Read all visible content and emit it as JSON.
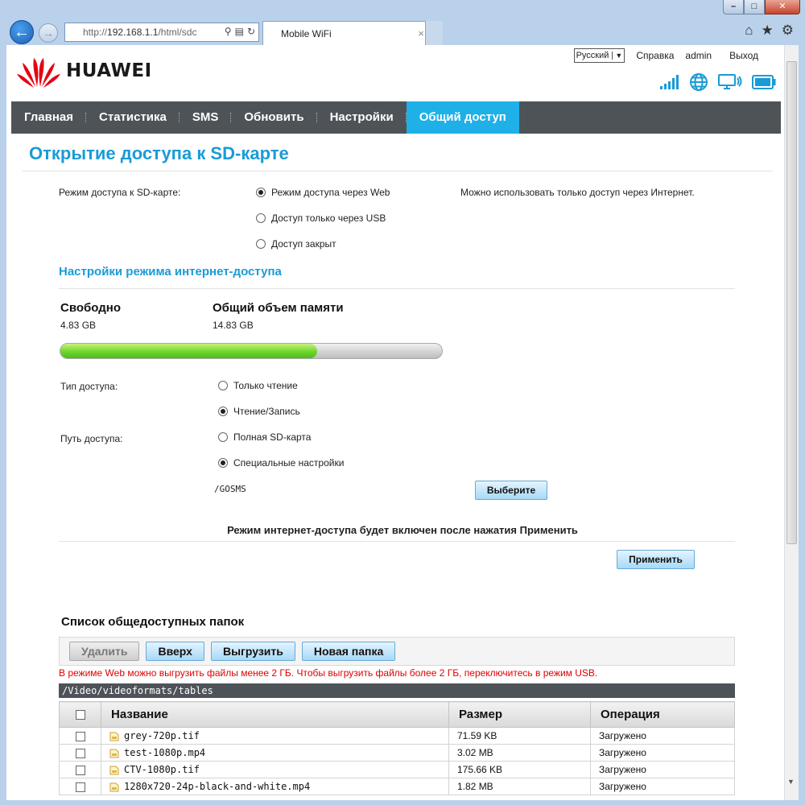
{
  "browser": {
    "address_prefix": "http://",
    "address_host": "192.168.1.1",
    "address_path": "/html/sdc",
    "tab_title": "Mobile WiFi",
    "tab_close": "×",
    "window_buttons": [
      "–",
      "□",
      "✕"
    ]
  },
  "header": {
    "logo_text": "HUAWEI",
    "language": "Русский",
    "links": {
      "help": "Справка",
      "user": "admin",
      "logout": "Выход"
    },
    "status_icons": [
      "signal-strength-icon",
      "globe-icon",
      "monitor-wifi-icon",
      "battery-icon"
    ]
  },
  "nav": {
    "items": [
      "Главная",
      "Статистика",
      "SMS",
      "Обновить",
      "Настройки",
      "Общий доступ"
    ],
    "active_index": 5
  },
  "page": {
    "title": "Открытие доступа к SD-карте",
    "access_mode": {
      "label": "Режим доступа к SD-карте:",
      "options": [
        "Режим доступа через Web",
        "Доступ только через USB",
        "Доступ закрыт"
      ],
      "selected": 0,
      "hint": "Можно использовать только доступ через Интернет."
    },
    "internet_section": {
      "title": "Настройки режима интернет-доступа",
      "free_label": "Свободно",
      "free_value": "4.83 GB",
      "total_label": "Общий объем памяти",
      "total_value": "14.83 GB",
      "used_fraction": 0.674
    },
    "access_type": {
      "label": "Тип доступа:",
      "options": [
        "Только чтение",
        "Чтение/Запись"
      ],
      "selected": 1
    },
    "access_path": {
      "label": "Путь доступа:",
      "options": [
        "Полная SD-карта",
        "Специальные настройки"
      ],
      "selected": 1,
      "path_value": "/GOSMS",
      "select_button": "Выберите"
    },
    "notice": "Режим интернет-доступа будет включен после нажатия Применить",
    "apply_button": "Применить"
  },
  "folders": {
    "title": "Список общедоступных папок",
    "toolbar": {
      "delete": "Удалить",
      "up": "Вверх",
      "upload": "Выгрузить",
      "new_folder": "Новая папка"
    },
    "warning": "В режиме Web можно выгрузить файлы менее 2 ГБ. Чтобы выгрузить файлы более 2 ГБ, переключитесь в режим USB.",
    "current_path": "/Video/videoformats/tables",
    "columns": {
      "name": "Название",
      "size": "Размер",
      "operation": "Операция"
    },
    "rows": [
      {
        "name": "grey-720p.tif",
        "size": "71.59 KB",
        "operation": "Загружено"
      },
      {
        "name": "test-1080p.mp4",
        "size": "3.02 MB",
        "operation": "Загружено"
      },
      {
        "name": "CTV-1080p.tif",
        "size": "175.66 KB",
        "operation": "Загружено"
      },
      {
        "name": "1280x720-24p-black-and-white.mp4",
        "size": "1.82 MB",
        "operation": "Загружено"
      }
    ]
  },
  "colors": {
    "accent": "#1a9bd7",
    "nav_bg": "#4e5358",
    "nav_active": "#1fb0e8",
    "warning": "#e00000"
  }
}
